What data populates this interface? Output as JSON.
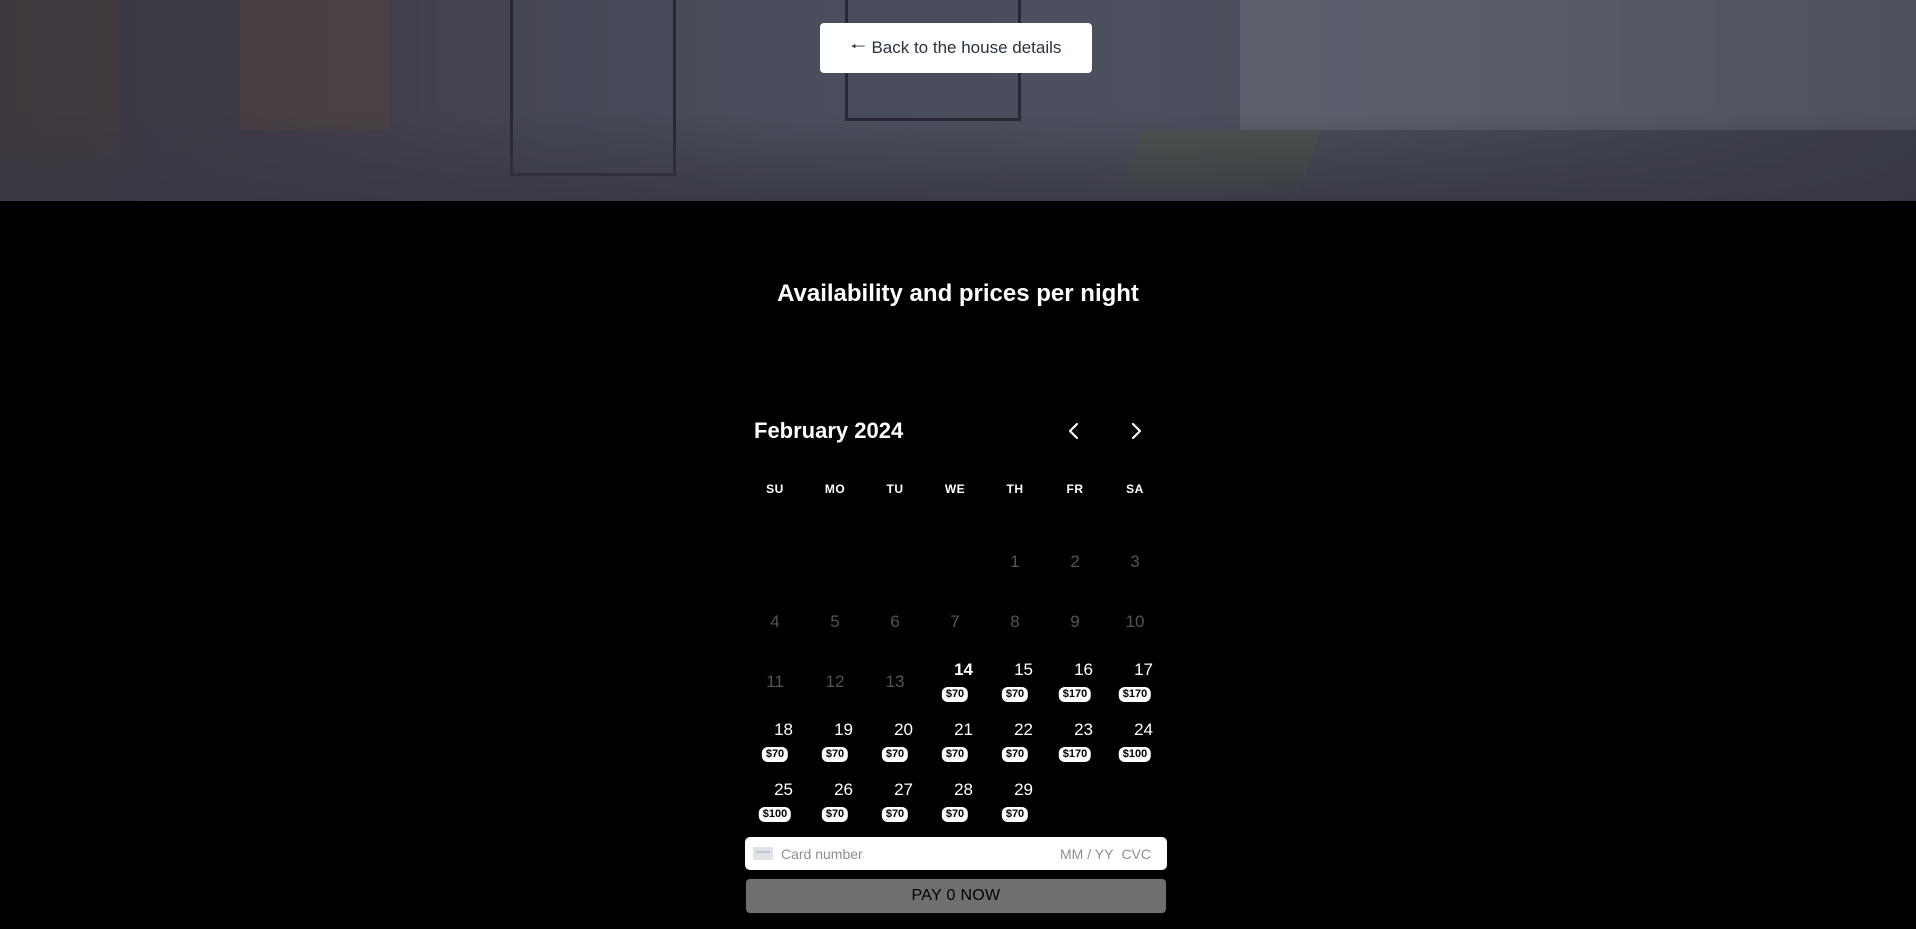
{
  "hero": {
    "back_button_label": "Back to the house details",
    "back_arrow": "🠐"
  },
  "availability": {
    "title": "Availability and prices per night"
  },
  "calendar": {
    "month_label": "February 2024",
    "weekdays": [
      "SU",
      "MO",
      "TU",
      "WE",
      "TH",
      "FR",
      "SA"
    ],
    "days": [
      {
        "n": "",
        "state": "empty"
      },
      {
        "n": "",
        "state": "empty"
      },
      {
        "n": "",
        "state": "empty"
      },
      {
        "n": "",
        "state": "empty"
      },
      {
        "n": "1",
        "state": "disabled"
      },
      {
        "n": "2",
        "state": "disabled"
      },
      {
        "n": "3",
        "state": "disabled"
      },
      {
        "n": "4",
        "state": "disabled"
      },
      {
        "n": "5",
        "state": "disabled"
      },
      {
        "n": "6",
        "state": "disabled"
      },
      {
        "n": "7",
        "state": "disabled"
      },
      {
        "n": "8",
        "state": "disabled"
      },
      {
        "n": "9",
        "state": "disabled"
      },
      {
        "n": "10",
        "state": "disabled"
      },
      {
        "n": "11",
        "state": "disabled"
      },
      {
        "n": "12",
        "state": "disabled"
      },
      {
        "n": "13",
        "state": "disabled"
      },
      {
        "n": "14",
        "state": "today",
        "price": "$70"
      },
      {
        "n": "15",
        "state": "avail",
        "price": "$70"
      },
      {
        "n": "16",
        "state": "avail",
        "price": "$170"
      },
      {
        "n": "17",
        "state": "avail",
        "price": "$170"
      },
      {
        "n": "18",
        "state": "avail",
        "price": "$70"
      },
      {
        "n": "19",
        "state": "avail",
        "price": "$70"
      },
      {
        "n": "20",
        "state": "avail",
        "price": "$70"
      },
      {
        "n": "21",
        "state": "avail",
        "price": "$70"
      },
      {
        "n": "22",
        "state": "avail",
        "price": "$70"
      },
      {
        "n": "23",
        "state": "avail",
        "price": "$170"
      },
      {
        "n": "24",
        "state": "avail",
        "price": "$100"
      },
      {
        "n": "25",
        "state": "avail",
        "price": "$100"
      },
      {
        "n": "26",
        "state": "avail",
        "price": "$70"
      },
      {
        "n": "27",
        "state": "avail",
        "price": "$70"
      },
      {
        "n": "28",
        "state": "avail",
        "price": "$70"
      },
      {
        "n": "29",
        "state": "avail",
        "price": "$70"
      }
    ]
  },
  "payment": {
    "card_number_placeholder": "Card number",
    "expiry_placeholder": "MM / YY",
    "cvc_placeholder": "CVC",
    "pay_button_label": "PAY 0 NOW"
  },
  "icons": {
    "prev": "chevron-left-icon",
    "next": "chevron-right-icon",
    "card": "credit-card-icon",
    "back": "arrow-left-icon"
  },
  "colors": {
    "background": "#000000",
    "text": "#ffffff",
    "disabled_day": "#555555",
    "price_badge_bg": "#ffffff",
    "pay_button_bg": "#6e6f71",
    "back_button_text": "#2b3240"
  }
}
